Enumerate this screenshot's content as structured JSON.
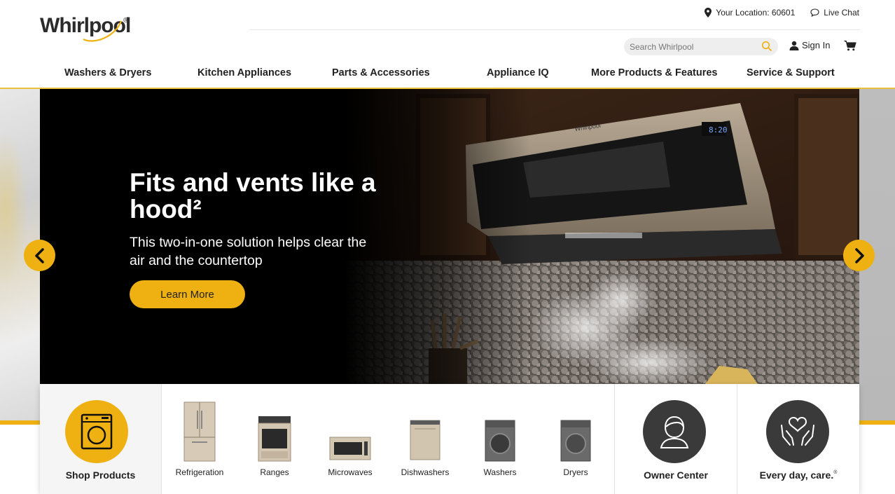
{
  "brand": {
    "logo_text": "Whirlpool",
    "registered": "®",
    "accent": "#EEB111"
  },
  "utility": {
    "location_label": "Your Location: 60601",
    "live_chat": "Live Chat"
  },
  "search": {
    "placeholder": "Search Whirlpool"
  },
  "account": {
    "sign_in": "Sign In"
  },
  "nav": [
    "Washers & Dryers",
    "Kitchen Appliances",
    "Parts & Accessories",
    "Appliance IQ",
    "More Products & Features",
    "Service & Support"
  ],
  "hero": {
    "title": "Fits and vents like a hood²",
    "subtitle": "This two-in-one solution helps clear the air and the countertop",
    "cta": "Learn More",
    "microwave_display": "8:20",
    "microwave_brand": "Whirlpool"
  },
  "categories": {
    "shop_label": "Shop Products",
    "products": [
      "Refrigeration",
      "Ranges",
      "Microwaves",
      "Dishwashers",
      "Washers",
      "Dryers"
    ],
    "owner_center": "Owner Center",
    "every_day_care": "Every day, care.",
    "every_day_care_mark": "®"
  },
  "icons": {
    "location": "map-pin-icon",
    "chat": "chat-bubble-icon",
    "search": "search-icon",
    "user": "user-icon",
    "cart": "cart-icon",
    "prev": "chevron-left-icon",
    "next": "chevron-right-icon",
    "washer": "washer-icon",
    "owner": "person-icon",
    "care": "hands-heart-icon"
  }
}
